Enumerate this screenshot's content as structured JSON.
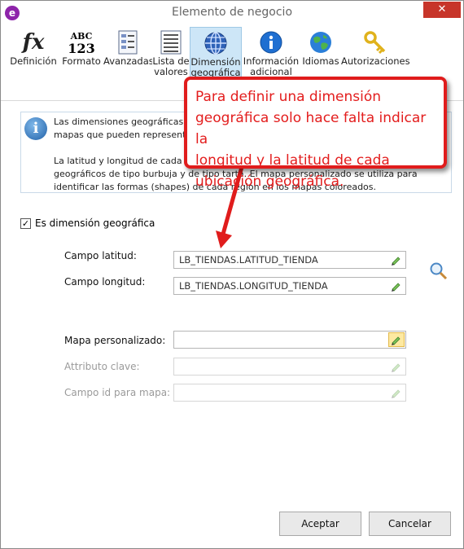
{
  "window": {
    "title": "Elemento de negocio",
    "close_glyph": "✕",
    "app_icon_glyph": "e"
  },
  "toolbar": {
    "items": [
      {
        "label": "Definición",
        "icon": "fx-icon"
      },
      {
        "label": "Formato",
        "icon": "abc123-icon"
      },
      {
        "label": "Avanzadas",
        "icon": "document-list-icon"
      },
      {
        "label": "Lista de\nvalores",
        "icon": "list-icon"
      },
      {
        "label": "Dimensión\ngeográfica",
        "icon": "globe-icon",
        "active": true
      },
      {
        "label": "Información\nadicional",
        "icon": "info-icon"
      },
      {
        "label": "Idiomas",
        "icon": "earth-icon"
      },
      {
        "label": "Autorizaciones",
        "icon": "key-icon"
      }
    ]
  },
  "info": {
    "p1": "Las dimensiones geográficas se utilizan para construir mapas. Existen dos tipos de mapas que pueden representar la información.",
    "p2": "La latitud y longitud de cada ubicación se utiliza para posicionar los elementos geográficos de tipo burbuja y de tipo tarta. El mapa personalizado se utiliza para identificar las formas (shapes) de cada región en los mapas coloreados."
  },
  "geo_checkbox": {
    "label": "Es dimensión geográfica",
    "checked": true,
    "glyph": "✓"
  },
  "fields": {
    "lat": {
      "label": "Campo latitud:",
      "value": "LB_TIENDAS.LATITUD_TIENDA"
    },
    "lon": {
      "label": "Campo longitud:",
      "value": "LB_TIENDAS.LONGITUD_TIENDA"
    },
    "map": {
      "label": "Mapa personalizado:",
      "value": ""
    },
    "key": {
      "label": "Attributo clave:",
      "value": ""
    },
    "mapid": {
      "label": "Campo id para mapa:",
      "value": ""
    }
  },
  "buttons": {
    "accept": "Aceptar",
    "cancel": "Cancelar"
  },
  "callout": {
    "lines": [
      "Para definir una dimensión",
      "geográfica solo hace falta indicar la",
      "longitud y la latitud de cada",
      "ubicación geográfica."
    ]
  },
  "colors": {
    "accent_red": "#e01c1c",
    "active_tab": "#cde6f7",
    "close_red": "#c7352a",
    "app_purple": "#8e24aa"
  }
}
